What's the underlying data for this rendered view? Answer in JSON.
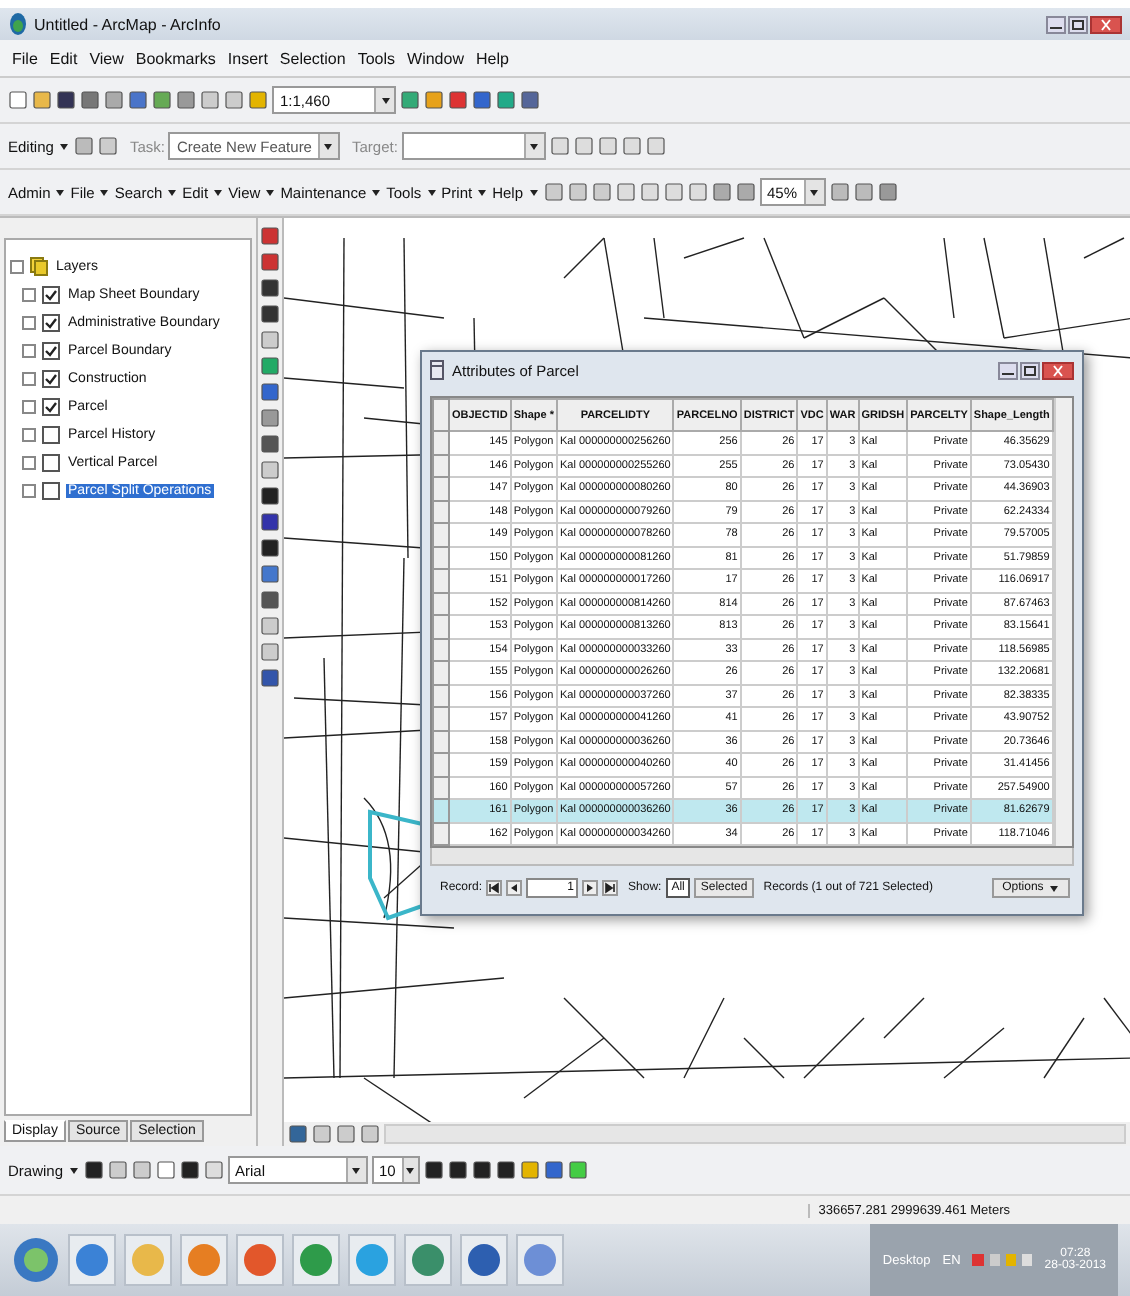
{
  "window": {
    "title": "Untitled - ArcMap - ArcInfo"
  },
  "menu": [
    "File",
    "Edit",
    "View",
    "Bookmarks",
    "Insert",
    "Selection",
    "Tools",
    "Window",
    "Help"
  ],
  "standard_toolbar": {
    "scale": "1:1,460"
  },
  "editor_toolbar": {
    "menu": "Editing",
    "task_label": "Task:",
    "task": "Create New Feature",
    "target_label": "Target:"
  },
  "custom_toolbar": {
    "menus": [
      "Admin",
      "File",
      "Search",
      "Edit",
      "View",
      "Maintenance",
      "Tools",
      "Print",
      "Help"
    ],
    "zoom": "45%"
  },
  "toc": {
    "root": "Layers",
    "layers": [
      {
        "name": "Map Sheet Boundary",
        "checked": true,
        "selected": false
      },
      {
        "name": "Administrative Boundary",
        "checked": true,
        "selected": false
      },
      {
        "name": "Parcel Boundary",
        "checked": true,
        "selected": false
      },
      {
        "name": "Construction",
        "checked": true,
        "selected": false
      },
      {
        "name": "Parcel",
        "checked": true,
        "selected": false
      },
      {
        "name": "Parcel History",
        "checked": false,
        "selected": false
      },
      {
        "name": "Vertical Parcel",
        "checked": false,
        "selected": false
      },
      {
        "name": "Parcel Split Operations",
        "checked": false,
        "selected": true
      }
    ],
    "tabs": [
      {
        "label": "Display",
        "selected": true
      },
      {
        "label": "Source",
        "selected": false
      },
      {
        "label": "Selection",
        "selected": false
      }
    ]
  },
  "attribute_table": {
    "title": "Attributes of Parcel",
    "columns": [
      "OBJECTID",
      "Shape *",
      "PARCELIDTY",
      "PARCELNO",
      "DISTRICT",
      "VDC",
      "WAR",
      "GRIDSH",
      "PARCELTY",
      "Shape_Length"
    ],
    "rows": [
      {
        "cells": [
          "145",
          "Polygon",
          "Kal 000000000256260",
          "256",
          "26",
          "17",
          "3",
          "Kal",
          "Private",
          "46.35629"
        ],
        "selected": false
      },
      {
        "cells": [
          "146",
          "Polygon",
          "Kal 000000000255260",
          "255",
          "26",
          "17",
          "3",
          "Kal",
          "Private",
          "73.05430"
        ],
        "selected": false
      },
      {
        "cells": [
          "147",
          "Polygon",
          "Kal 000000000080260",
          "80",
          "26",
          "17",
          "3",
          "Kal",
          "Private",
          "44.36903"
        ],
        "selected": false
      },
      {
        "cells": [
          "148",
          "Polygon",
          "Kal 000000000079260",
          "79",
          "26",
          "17",
          "3",
          "Kal",
          "Private",
          "62.24334"
        ],
        "selected": false
      },
      {
        "cells": [
          "149",
          "Polygon",
          "Kal 000000000078260",
          "78",
          "26",
          "17",
          "3",
          "Kal",
          "Private",
          "79.57005"
        ],
        "selected": false
      },
      {
        "cells": [
          "150",
          "Polygon",
          "Kal 000000000081260",
          "81",
          "26",
          "17",
          "3",
          "Kal",
          "Private",
          "51.79859"
        ],
        "selected": false
      },
      {
        "cells": [
          "151",
          "Polygon",
          "Kal 000000000017260",
          "17",
          "26",
          "17",
          "3",
          "Kal",
          "Private",
          "116.06917"
        ],
        "selected": false
      },
      {
        "cells": [
          "152",
          "Polygon",
          "Kal 000000000814260",
          "814",
          "26",
          "17",
          "3",
          "Kal",
          "Private",
          "87.67463"
        ],
        "selected": false
      },
      {
        "cells": [
          "153",
          "Polygon",
          "Kal 000000000813260",
          "813",
          "26",
          "17",
          "3",
          "Kal",
          "Private",
          "83.15641"
        ],
        "selected": false
      },
      {
        "cells": [
          "154",
          "Polygon",
          "Kal 000000000033260",
          "33",
          "26",
          "17",
          "3",
          "Kal",
          "Private",
          "118.56985"
        ],
        "selected": false
      },
      {
        "cells": [
          "155",
          "Polygon",
          "Kal 000000000026260",
          "26",
          "26",
          "17",
          "3",
          "Kal",
          "Private",
          "132.20681"
        ],
        "selected": false
      },
      {
        "cells": [
          "156",
          "Polygon",
          "Kal 000000000037260",
          "37",
          "26",
          "17",
          "3",
          "Kal",
          "Private",
          "82.38335"
        ],
        "selected": false
      },
      {
        "cells": [
          "157",
          "Polygon",
          "Kal 000000000041260",
          "41",
          "26",
          "17",
          "3",
          "Kal",
          "Private",
          "43.90752"
        ],
        "selected": false
      },
      {
        "cells": [
          "158",
          "Polygon",
          "Kal 000000000036260",
          "36",
          "26",
          "17",
          "3",
          "Kal",
          "Private",
          "20.73646"
        ],
        "selected": false
      },
      {
        "cells": [
          "159",
          "Polygon",
          "Kal 000000000040260",
          "40",
          "26",
          "17",
          "3",
          "Kal",
          "Private",
          "31.41456"
        ],
        "selected": false
      },
      {
        "cells": [
          "160",
          "Polygon",
          "Kal 000000000057260",
          "57",
          "26",
          "17",
          "3",
          "Kal",
          "Private",
          "257.54900"
        ],
        "selected": false
      },
      {
        "cells": [
          "161",
          "Polygon",
          "Kal 000000000036260",
          "36",
          "26",
          "17",
          "3",
          "Kal",
          "Private",
          "81.62679"
        ],
        "selected": true
      },
      {
        "cells": [
          "162",
          "Polygon",
          "Kal 000000000034260",
          "34",
          "26",
          "17",
          "3",
          "Kal",
          "Private",
          "118.71046"
        ],
        "selected": false
      }
    ],
    "footer": {
      "record_label": "Record:",
      "record": "1",
      "show_label": "Show:",
      "show_options": [
        {
          "label": "All",
          "selected": true
        },
        {
          "label": "Selected",
          "selected": false
        }
      ],
      "status": "Records (1 out of 721 Selected)",
      "options": "Options"
    }
  },
  "drawing_toolbar": {
    "menu": "Drawing",
    "font": "Arial",
    "size": "10"
  },
  "status_bar": {
    "coordinates": "336657.281 2999639.461 Meters"
  },
  "taskbar": {
    "tray_label": "Desktop",
    "language": "EN",
    "time": "07:28",
    "date": "28-03-2013"
  }
}
